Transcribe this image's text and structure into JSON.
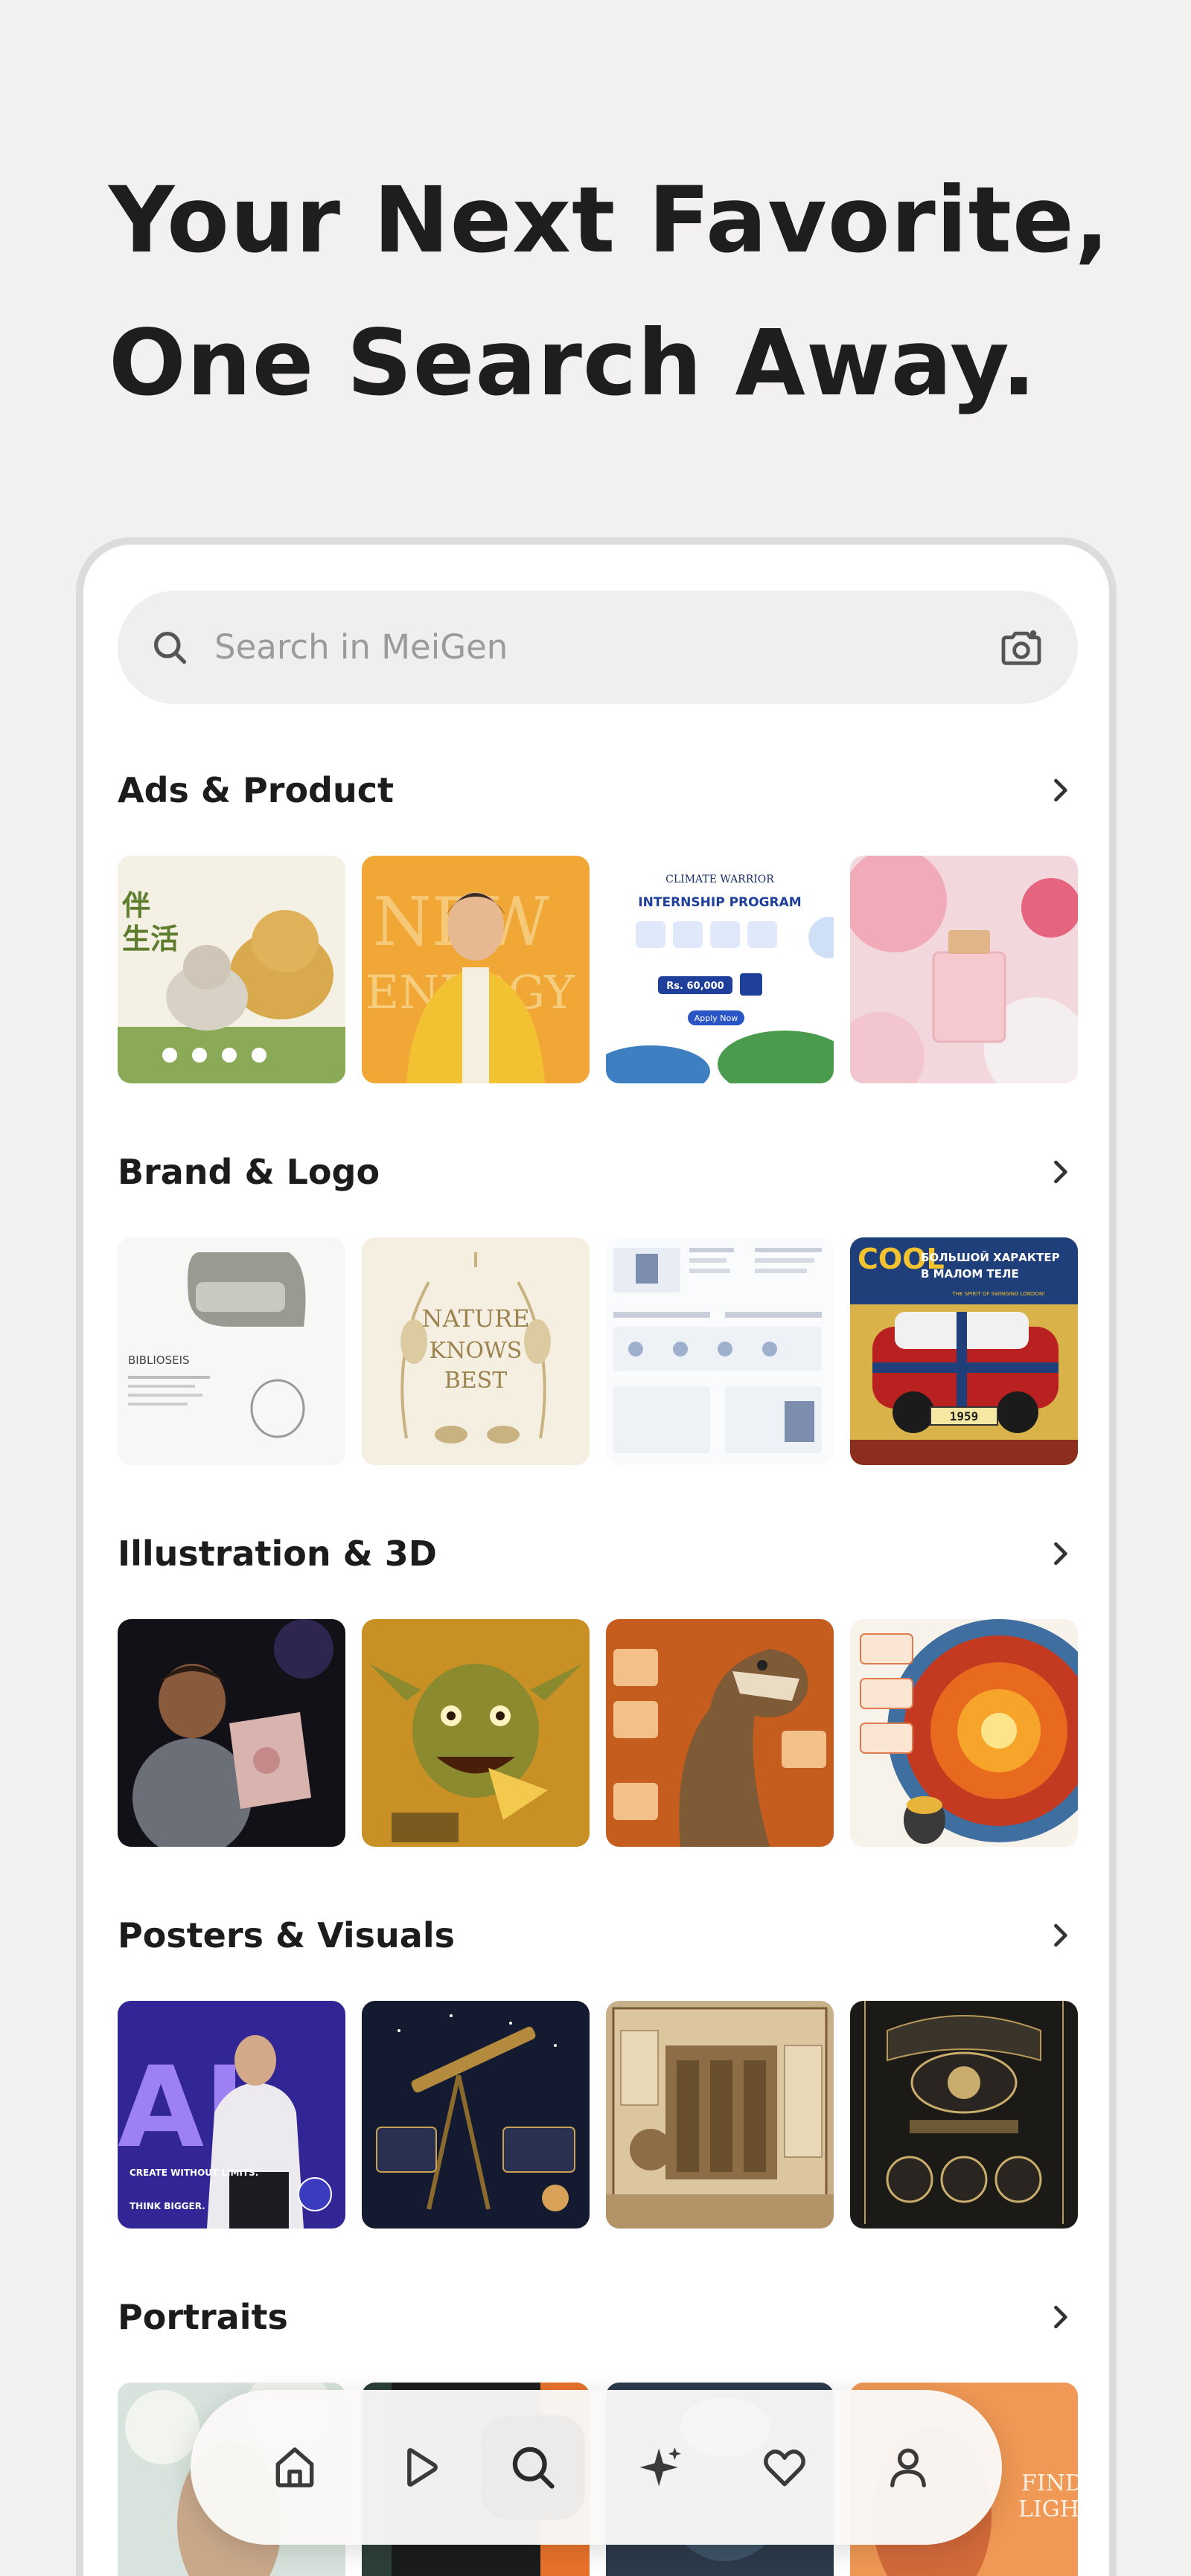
{
  "hero": {
    "line1": "Your Next Favorite,",
    "line2": "One Search Away."
  },
  "search": {
    "placeholder": "Search in MeiGen",
    "icon": "search-icon",
    "camera_icon": "camera-icon"
  },
  "sections": [
    {
      "title": "Ads & Product",
      "arrow": "chevron-right-icon",
      "items": [
        {
          "texts": [
            "伴",
            "生活"
          ]
        },
        {
          "texts": [
            "NEW",
            "ENERGY"
          ]
        },
        {
          "texts": [
            "CLIMATE WARRIOR",
            "INTERNSHIP PROGRAM",
            "Rs. 60,000",
            "Apply Now"
          ]
        },
        {
          "texts": []
        }
      ]
    },
    {
      "title": "Brand & Logo",
      "arrow": "chevron-right-icon",
      "items": [
        {
          "texts": [
            "BIBLIOSEIS"
          ]
        },
        {
          "texts": [
            "NATURE",
            "KNOWS",
            "BEST"
          ]
        },
        {
          "texts": []
        },
        {
          "texts": [
            "COOL",
            "БОЛЬШОЙ ХАРАКТЕР",
            "В МАЛОМ ТЕЛЕ",
            "THE SPIRIT OF SWINGING LONDON!",
            "1959"
          ]
        }
      ]
    },
    {
      "title": "Illustration & 3D",
      "arrow": "chevron-right-icon",
      "items": [
        {
          "texts": []
        },
        {
          "texts": []
        },
        {
          "texts": []
        },
        {
          "texts": []
        }
      ]
    },
    {
      "title": "Posters & Visuals",
      "arrow": "chevron-right-icon",
      "items": [
        {
          "texts": [
            "AI",
            "CREATE WITHOUT LIMITS.",
            "THINK BIGGER."
          ]
        },
        {
          "texts": []
        },
        {
          "texts": []
        },
        {
          "texts": []
        }
      ]
    },
    {
      "title": "Portraits",
      "arrow": "chevron-right-icon",
      "items": [
        {
          "texts": []
        },
        {
          "texts": []
        },
        {
          "texts": []
        },
        {
          "texts": [
            "FIND",
            "LIGHT"
          ]
        }
      ]
    }
  ],
  "nav": {
    "items": [
      {
        "name": "home",
        "icon": "home-icon"
      },
      {
        "name": "play",
        "icon": "play-icon"
      },
      {
        "name": "search",
        "icon": "search-icon",
        "active": true
      },
      {
        "name": "create",
        "icon": "sparkle-icon"
      },
      {
        "name": "favorites",
        "icon": "heart-icon"
      },
      {
        "name": "profile",
        "icon": "profile-icon"
      }
    ]
  },
  "colors": {
    "background": "#f2f1ef",
    "card": "#ffffff",
    "search_bg": "#efefef",
    "text": "#1c1c1c",
    "placeholder": "#9b9b9b"
  }
}
